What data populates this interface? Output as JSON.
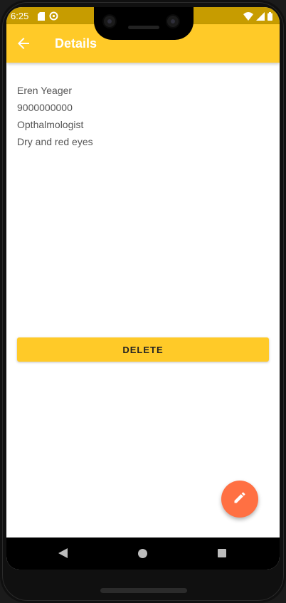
{
  "status_bar": {
    "time": "6:25",
    "left_icons": [
      "sd-card-icon",
      "sync-icon"
    ],
    "right_icons": [
      "wifi-icon",
      "signal-icon",
      "battery-icon"
    ],
    "color": "#c79c00"
  },
  "app_bar": {
    "title": "Details",
    "back_icon": "arrow-back-icon",
    "color": "#ffca28"
  },
  "details": {
    "name": "Eren Yeager",
    "phone": "9000000000",
    "specialty": "Opthalmologist",
    "symptoms": "Dry and red eyes"
  },
  "actions": {
    "delete_label": "DELETE",
    "edit_icon": "edit-pencil-icon",
    "fab_color": "#ff7043"
  },
  "nav_bar": {
    "buttons": [
      "back-triangle-icon",
      "home-circle-icon",
      "recents-square-icon"
    ]
  }
}
